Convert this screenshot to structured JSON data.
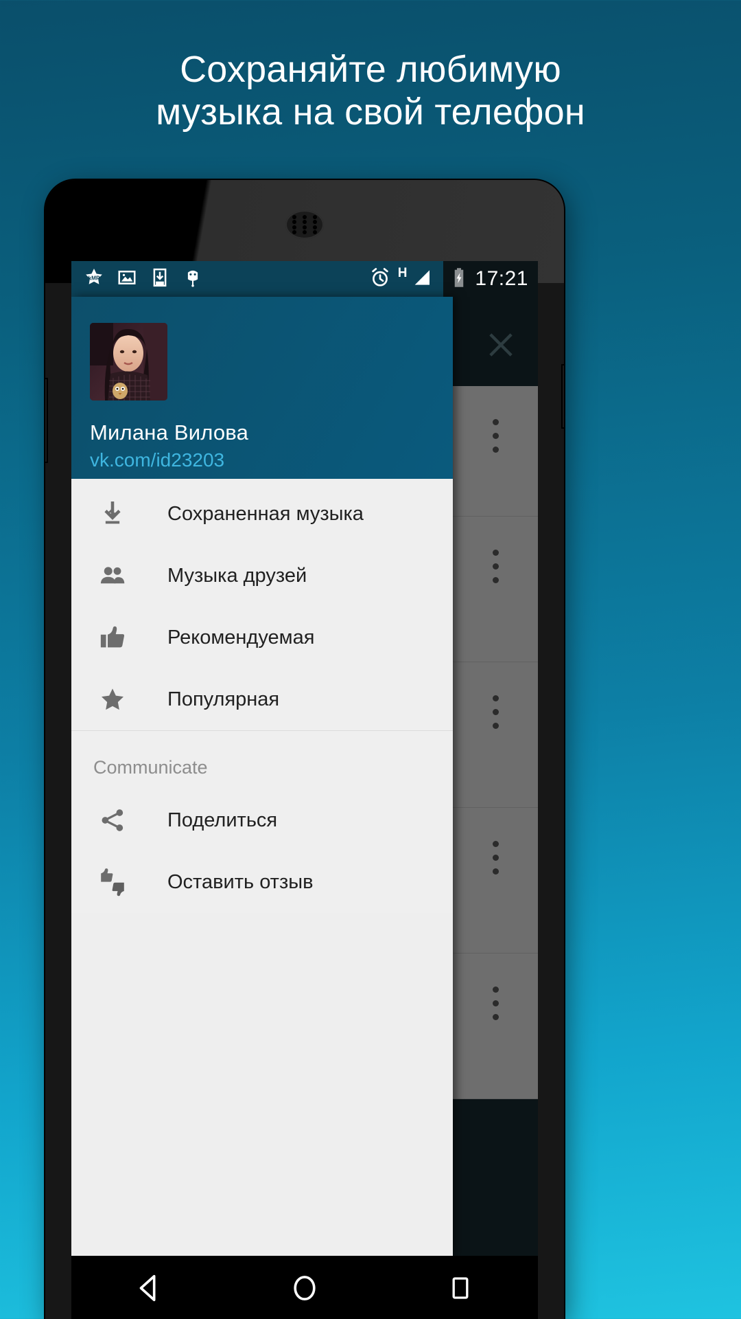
{
  "promo": {
    "headline_line1": "Сохраняйте любимую",
    "headline_line2": "музыка на свой телефон",
    "background_top": "#0a4f6b",
    "background_bottom": "#1fc3e0"
  },
  "statusbar": {
    "left_icons": [
      "kmp-star-icon",
      "gallery-image-icon",
      "download-to-phone-icon",
      "android-robot-icon"
    ],
    "alarm_icon": "alarm-clock-icon",
    "network_label": "H",
    "signal_icon": "signal-bars-icon",
    "battery_icon": "battery-charging-icon",
    "time": "17:21",
    "bg_color": "#0c4258"
  },
  "drawer": {
    "header_bg": "#0a5a7d",
    "profile": {
      "name": "Милана Вилова",
      "url": "vk.com/id23203",
      "avatar": "user-photo-avatar",
      "url_color": "#3fb6e0"
    },
    "primary_items": [
      {
        "icon": "download-icon",
        "label": "Сохраненная музыка"
      },
      {
        "icon": "people-icon",
        "label": "Музыка друзей"
      },
      {
        "icon": "thumb-up-icon",
        "label": "Рекомендуемая"
      },
      {
        "icon": "star-icon",
        "label": "Популярная"
      }
    ],
    "secondary_title": "Communicate",
    "secondary_items": [
      {
        "icon": "share-icon",
        "label": "Поделиться"
      },
      {
        "icon": "thumbs-up-down-icon",
        "label": "Оставить отзыв"
      }
    ]
  },
  "behind": {
    "close_icon": "close-x-icon",
    "overflow_icon": "overflow-menu-icon",
    "row_count": 5
  },
  "navbar": {
    "back": "back-triangle-icon",
    "home": "home-circle-icon",
    "recents": "recents-square-icon"
  }
}
